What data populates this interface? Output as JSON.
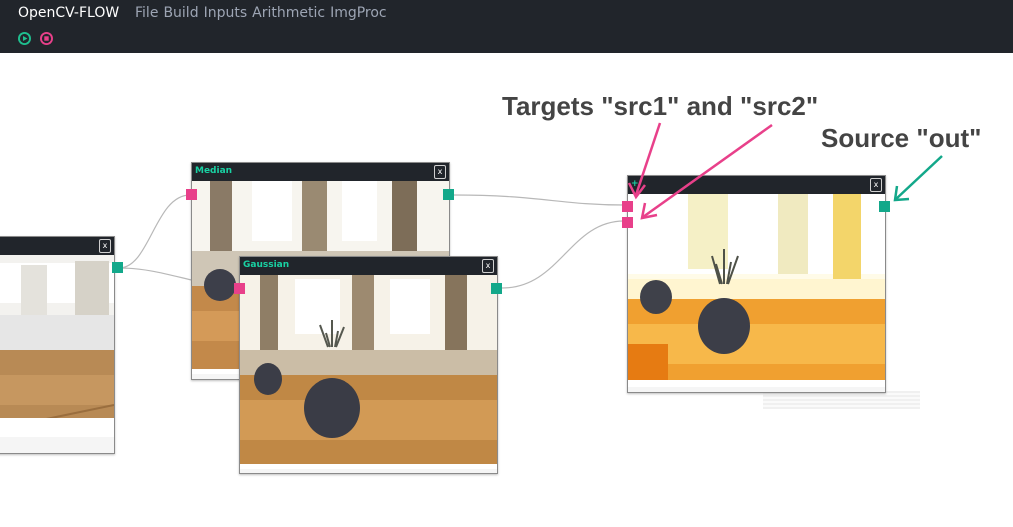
{
  "app": {
    "title": "OpenCV-FLOW",
    "menu": [
      {
        "label": "File"
      },
      {
        "label": "Build"
      },
      {
        "label": "Inputs"
      },
      {
        "label": "Arithmetic"
      },
      {
        "label": "ImgProc"
      }
    ]
  },
  "toolbar": {
    "run_icon": "play-icon",
    "stop_icon": "stop-icon",
    "run_color": "#1fbf8f",
    "stop_color": "#e8408a"
  },
  "nodes": {
    "source": {
      "title": "",
      "close": "x"
    },
    "median": {
      "title": "Median",
      "close": "x"
    },
    "gaussian": {
      "title": "Gaussian",
      "close": "x"
    },
    "add": {
      "title": "+",
      "close": "x"
    }
  },
  "annotations": {
    "targets": "Targets \"src1\" and \"src2\"",
    "source": "Source \"out\""
  },
  "colors": {
    "input_port": "#e8408a",
    "output_port": "#13a88a",
    "node_title": "#19d1a3",
    "header": "#21252b",
    "edge": "#b8b8b8"
  }
}
